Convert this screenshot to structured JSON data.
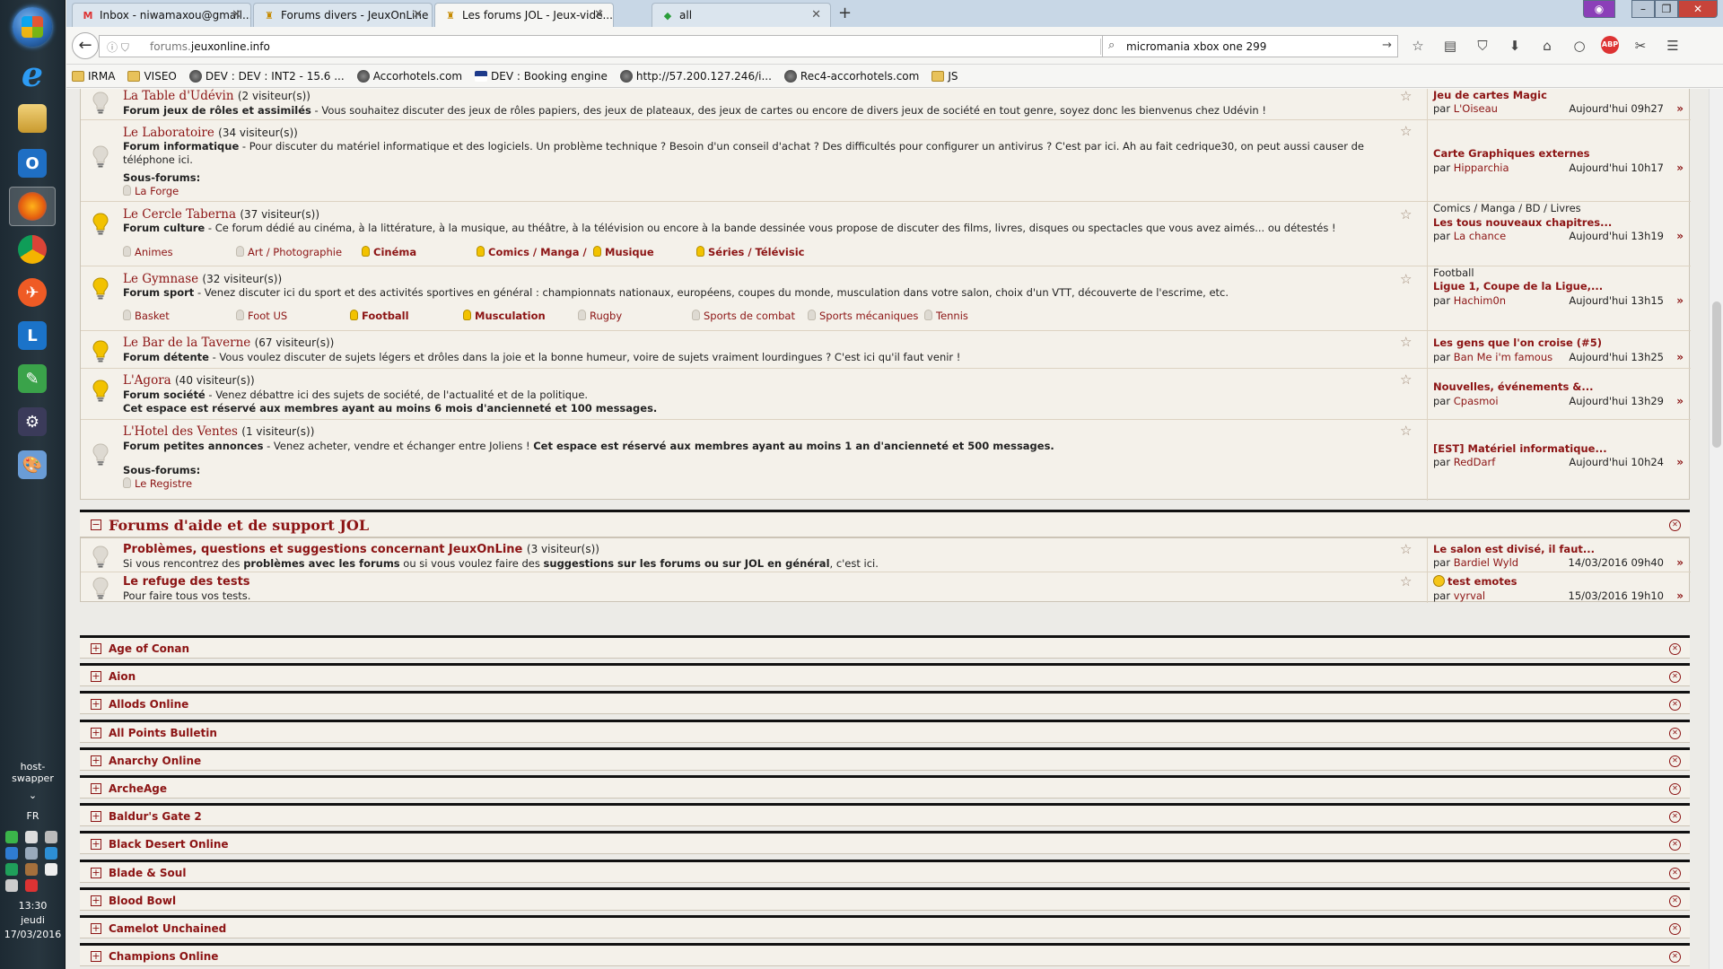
{
  "taskbar": {
    "host_swapper": "host-swapper",
    "lang": "FR",
    "time": "13:30",
    "day": "jeudi",
    "date": "17/03/2016"
  },
  "tabs": [
    {
      "label": "Inbox - niwamaxou@gmail...",
      "icon": "gmail-icon",
      "active": false
    },
    {
      "label": "Forums divers - JeuxOnLine",
      "icon": "jol-icon",
      "active": false
    },
    {
      "label": "Les forums JOL - Jeux-vidé...",
      "icon": "jol-icon",
      "active": true
    },
    {
      "label": "all",
      "icon": "green-leaf-icon",
      "active": false
    }
  ],
  "nav": {
    "url_prefix": "forums.",
    "url_domain": "jeuxonline.info",
    "search_query": "micromania xbox one 299"
  },
  "bookmarks": [
    {
      "label": "IRMA",
      "icon": "folder-icon"
    },
    {
      "label": "VISEO",
      "icon": "folder-icon"
    },
    {
      "label": "DEV : DEV : INT2 - 15.6 ...",
      "icon": "globe-icon"
    },
    {
      "label": "Accorhotels.com",
      "icon": "globe-icon"
    },
    {
      "label": "DEV : Booking engine",
      "icon": "flag-icon"
    },
    {
      "label": "http://57.200.127.246/i...",
      "icon": "globe-icon"
    },
    {
      "label": "Rec4-accorhotels.com",
      "icon": "globe-icon"
    },
    {
      "label": "JS",
      "icon": "folder-icon"
    }
  ],
  "forums": [
    {
      "title": "La Table d'Udévin",
      "visitors": "(2 visiteur(s))",
      "lit": false,
      "desc_bold": "Forum jeux de rôles et assimilés",
      "desc": " - Vous souhaitez discuter des jeux de rôles papiers, des jeux de plateaux, des jeux de cartes ou encore de divers jeux de société en tout genre, soyez donc les bienvenus chez Udévin !",
      "last": {
        "cat": "",
        "topic": "Jeu de cartes Magic",
        "by_label": "par",
        "user": "L'Oiseau",
        "date": "Aujourd'hui 09h27"
      }
    },
    {
      "title": "Le Laboratoire",
      "visitors": "(34 visiteur(s))",
      "lit": false,
      "desc_bold": "Forum informatique",
      "desc": " - Pour discuter du matériel informatique et des logiciels. Un problème technique ? Besoin d'un conseil d'achat ? Des difficultés pour configurer un antivirus ? C'est par ici. Ah au fait cedrique30, on peut aussi causer de téléphone ici.",
      "sub_label": "Sous-forums:",
      "subs": [
        {
          "label": "La Forge",
          "lit": false
        }
      ],
      "last": {
        "cat": "",
        "topic": "Carte Graphiques externes",
        "by_label": "par",
        "user": "Hipparchia",
        "date": "Aujourd'hui 10h17"
      }
    },
    {
      "title": "Le Cercle Taberna",
      "visitors": "(37 visiteur(s))",
      "lit": true,
      "desc_bold": "Forum culture",
      "desc": " - Ce forum dédié au cinéma, à la littérature, à la musique, au théâtre, à la télévision ou encore à la bande dessinée vous propose de discuter des films, livres, disques ou spectacles que vous avez aimés... ou détestés !",
      "subs": [
        {
          "label": "Animes",
          "lit": false
        },
        {
          "label": "Art / Photographie",
          "lit": false
        },
        {
          "label": "Cinéma",
          "lit": true
        },
        {
          "label": "Comics / Manga /",
          "lit": true
        },
        {
          "label": "Musique",
          "lit": true
        },
        {
          "label": "Séries / Télévisic",
          "lit": true
        }
      ],
      "last": {
        "cat": "Comics / Manga / BD / Livres",
        "topic": "Les tous nouveaux chapitres...",
        "by_label": "par",
        "user": "La chance",
        "date": "Aujourd'hui 13h19"
      }
    },
    {
      "title": "Le Gymnase",
      "visitors": "(32 visiteur(s))",
      "lit": true,
      "desc_bold": "Forum sport",
      "desc": " - Venez discuter ici du sport et des activités sportives en général : championnats nationaux, européens, coupes du monde, musculation dans votre salon, choix d'un VTT, découverte de l'escrime, etc.",
      "subs": [
        {
          "label": "Basket",
          "lit": false
        },
        {
          "label": "Foot US",
          "lit": false
        },
        {
          "label": "Football",
          "lit": true
        },
        {
          "label": "Musculation",
          "lit": true
        },
        {
          "label": "Rugby",
          "lit": false
        },
        {
          "label": "Sports de combat",
          "lit": false
        },
        {
          "label": "Sports mécaniques",
          "lit": false
        },
        {
          "label": "Tennis",
          "lit": false
        }
      ],
      "last": {
        "cat": "Football",
        "topic": "Ligue 1, Coupe de la Ligue,...",
        "by_label": "par",
        "user": "Hachim0n",
        "date": "Aujourd'hui 13h15"
      }
    },
    {
      "title": "Le Bar de la Taverne",
      "visitors": "(67 visiteur(s))",
      "lit": true,
      "desc_bold": "Forum détente",
      "desc": " - Vous voulez discuter de sujets légers et drôles dans la joie et la bonne humeur, voire de sujets vraiment lourdingues ? C'est ici qu'il faut venir !",
      "last": {
        "cat": "",
        "topic": "Les gens que l'on croise (#5)",
        "by_label": "par",
        "user": "Ban Me i'm famous",
        "date": "Aujourd'hui 13h25"
      }
    },
    {
      "title": "L'Agora",
      "visitors": "(40 visiteur(s))",
      "lit": true,
      "desc_bold": "Forum société",
      "desc": " - Venez débattre ici des sujets de société, de l'actualité et de la politique.",
      "desc_line2": "Cet espace est réservé aux membres ayant au moins 6 mois d'ancienneté et 100 messages.",
      "last": {
        "cat": "",
        "topic": "Nouvelles, événements &...",
        "by_label": "par",
        "user": "Cpasmoi",
        "date": "Aujourd'hui 13h29"
      }
    },
    {
      "title": "L'Hotel des Ventes",
      "visitors": "(1 visiteur(s))",
      "lit": false,
      "desc_bold": "Forum petites annonces",
      "desc": " - Venez acheter, vendre et échanger entre Joliens ! ",
      "desc_bold2": "Cet espace est réservé aux membres ayant au moins 1 an d'ancienneté et 500 messages.",
      "sub_label": "Sous-forums:",
      "subs": [
        {
          "label": "Le Registre",
          "lit": false
        }
      ],
      "last": {
        "cat": "",
        "topic": "[EST] Matériel informatique...",
        "by_label": "par",
        "user": "RedDarf",
        "date": "Aujourd'hui 10h24"
      }
    }
  ],
  "support": {
    "title": "Forums d'aide et de support JOL",
    "rows": [
      {
        "title": "Problèmes, questions et suggestions concernant JeuxOnLine",
        "visitors": "(3 visiteur(s))",
        "desc_a": "Si vous rencontrez des ",
        "desc_b": "problèmes avec les forums",
        "desc_c": " ou si vous voulez faire des ",
        "desc_d": "suggestions sur les forums ou sur JOL en général",
        "desc_e": ", c'est ici.",
        "last": {
          "topic": "Le salon est divisé, il faut...",
          "by_label": "par",
          "user": "Bardiel Wyld",
          "date": "14/03/2016 09h40"
        }
      },
      {
        "title": "Le refuge des tests",
        "visitors": "",
        "desc_a": "Pour faire tous vos tests.",
        "last": {
          "topic": "test emotes",
          "topic_icon": "smiley-icon",
          "by_label": "par",
          "user": "vyrval",
          "date": "15/03/2016 19h10"
        }
      }
    ]
  },
  "sections": [
    "Age of Conan",
    "Aion",
    "Allods Online",
    "All Points Bulletin",
    "Anarchy Online",
    "ArcheAge",
    "Baldur's Gate 2",
    "Black Desert Online",
    "Blade & Soul",
    "Blood Bowl",
    "Camelot Unchained",
    "Champions Online"
  ],
  "colors": {
    "accent": "#8c1414",
    "bulb_lit": "#f2c200",
    "bulb_unlit": "#dedad2"
  }
}
